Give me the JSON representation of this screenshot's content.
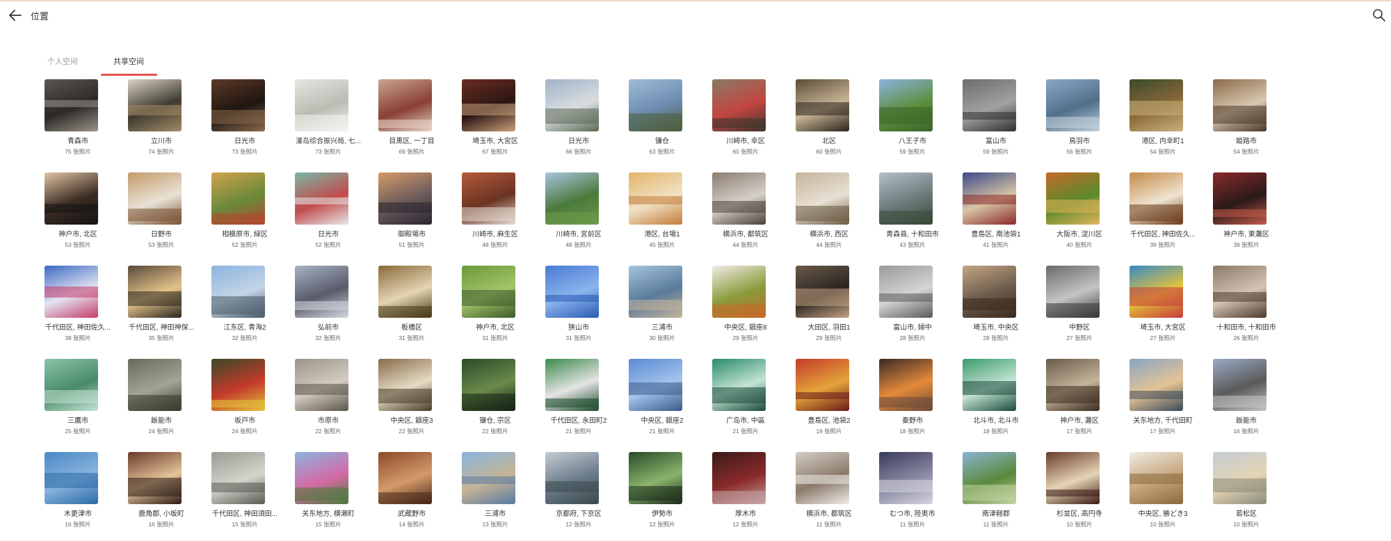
{
  "header": {
    "title": "位置",
    "back_icon": "arrow-left-icon",
    "search_icon": "search-icon"
  },
  "tabs": [
    {
      "label": "个人空间",
      "active": false
    },
    {
      "label": "共享空间",
      "active": true
    }
  ],
  "colors": {
    "accent": "#e4544d"
  },
  "locations": [
    {
      "place": "青森市",
      "count": "75 张照片",
      "colors": [
        "#5a5650",
        "#2b2926",
        "#9a948a"
      ]
    },
    {
      "place": "立川市",
      "count": "74 张照片",
      "colors": [
        "#d9d4c4",
        "#3f3a30",
        "#a48c66"
      ]
    },
    {
      "place": "日光市",
      "count": "73 张照片",
      "colors": [
        "#5c3a28",
        "#1e1511",
        "#8a6a4a"
      ]
    },
    {
      "place": "濠岛综合振兴局, 七...",
      "count": "73 张照片",
      "colors": [
        "#e6e6e2",
        "#bcbcb4",
        "#f4f4f0"
      ]
    },
    {
      "place": "目黒区, 一丁目",
      "count": "69 张照片",
      "colors": [
        "#c9a58f",
        "#8a3f35",
        "#e8d5c8"
      ]
    },
    {
      "place": "埼玉市, 大宮区",
      "count": "67 张照片",
      "colors": [
        "#6b2c22",
        "#2a1512",
        "#c9a07a"
      ]
    },
    {
      "place": "日光市",
      "count": "66 张照片",
      "colors": [
        "#9fb2c9",
        "#d9dde0",
        "#5b6a55"
      ]
    },
    {
      "place": "镰仓",
      "count": "63 张照片",
      "colors": [
        "#9fbcd6",
        "#6d8bb0",
        "#4c5e3a"
      ]
    },
    {
      "place": "川崎市, 幸区",
      "count": "60 张照片",
      "colors": [
        "#8a7a66",
        "#c2463e",
        "#3c3630"
      ]
    },
    {
      "place": "北区",
      "count": "60 张照片",
      "colors": [
        "#5c4c38",
        "#c8b496",
        "#2b241c"
      ]
    },
    {
      "place": "八王子市",
      "count": "59 张照片",
      "colors": [
        "#8bb3df",
        "#5d8f3e",
        "#3b6427"
      ]
    },
    {
      "place": "富山市",
      "count": "59 张照片",
      "colors": [
        "#6a6c6e",
        "#9fa1a3",
        "#2e3032"
      ]
    },
    {
      "place": "鳥羽市",
      "count": "56 张照片",
      "colors": [
        "#8aa8c4",
        "#50708a",
        "#c4d2dc"
      ]
    },
    {
      "place": "港区, 内幸町1",
      "count": "54 张照片",
      "colors": [
        "#3a4a2a",
        "#8c6a3a",
        "#c9b27a"
      ]
    },
    {
      "place": "姫路市",
      "count": "54 张照片",
      "colors": [
        "#8c6a4a",
        "#d8c8b0",
        "#4a3626"
      ]
    },
    {
      "place": "神户市, 北区",
      "count": "53 张照片",
      "colors": [
        "#e0c4a4",
        "#3c2c24",
        "#141414"
      ]
    },
    {
      "place": "日野市",
      "count": "53 张照片",
      "colors": [
        "#c49a6a",
        "#e8e2d6",
        "#7a5232"
      ]
    },
    {
      "place": "相模原市, 緑区",
      "count": "52 张照片",
      "colors": [
        "#d2a24a",
        "#6a8a3a",
        "#b04830"
      ]
    },
    {
      "place": "日光市",
      "count": "52 张照片",
      "colors": [
        "#7ab8a8",
        "#c24a4a",
        "#e6e8ea"
      ]
    },
    {
      "place": "御殿場市",
      "count": "51 张照片",
      "colors": [
        "#d69a6a",
        "#6a5a5a",
        "#2a2430"
      ]
    },
    {
      "place": "川崎市, 麻生区",
      "count": "48 张照片",
      "colors": [
        "#b45a3a",
        "#6a3422",
        "#e6dcd4"
      ]
    },
    {
      "place": "川崎市, 宮前区",
      "count": "48 张照片",
      "colors": [
        "#a8c4e0",
        "#4a7a3a",
        "#6b9a4a"
      ]
    },
    {
      "place": "港区, 台場1",
      "count": "45 张照片",
      "colors": [
        "#e4b46a",
        "#f0e2c4",
        "#c47a3a"
      ]
    },
    {
      "place": "横浜市, 都筑区",
      "count": "44 张照片",
      "colors": [
        "#8a7c70",
        "#d6d0c8",
        "#4a4038"
      ]
    },
    {
      "place": "横浜市, 西区",
      "count": "44 张照片",
      "colors": [
        "#c4b49a",
        "#e8e0d4",
        "#6a5a42"
      ]
    },
    {
      "place": "青森县, 十和田市",
      "count": "43 张照片",
      "colors": [
        "#b4c0c8",
        "#6a7a7a",
        "#3a4a3a"
      ]
    },
    {
      "place": "豊島区, 南池袋1",
      "count": "41 张照片",
      "colors": [
        "#3a4a8a",
        "#d8c4a4",
        "#8a2a2a"
      ]
    },
    {
      "place": "大阪市, 淀川区",
      "count": "40 张照片",
      "colors": [
        "#c46a2a",
        "#5a8a2a",
        "#e4b45a"
      ]
    },
    {
      "place": "千代田区, 神田佐久...",
      "count": "39 张照片",
      "colors": [
        "#c48a4a",
        "#f0e4d0",
        "#6a3a1a"
      ]
    },
    {
      "place": "神户市, 東灘区",
      "count": "39 张照片",
      "colors": [
        "#8a2a2a",
        "#2a1a1a",
        "#c45a4a"
      ]
    },
    {
      "place": "千代田区, 神田佐久...",
      "count": "38 张照片",
      "colors": [
        "#3a6ac4",
        "#e4e4f0",
        "#c43a6a"
      ]
    },
    {
      "place": "千代田区, 神田神保...",
      "count": "35 张照片",
      "colors": [
        "#5a4a3a",
        "#e4c48a",
        "#2a241e"
      ]
    },
    {
      "place": "江东区, 青海2",
      "count": "32 张照片",
      "colors": [
        "#8ab4e0",
        "#c4d4e4",
        "#4a5a6a"
      ]
    },
    {
      "place": "弘前市",
      "count": "32 张照片",
      "colors": [
        "#a4b4c4",
        "#5a5a6a",
        "#d4dae0"
      ]
    },
    {
      "place": "板橋区",
      "count": "31 张照片",
      "colors": [
        "#8a6a3a",
        "#e4d4b4",
        "#4a3a1a"
      ]
    },
    {
      "place": "神户市, 北区",
      "count": "31 张照片",
      "colors": [
        "#6a9a3a",
        "#a4c46a",
        "#3a5a2a"
      ]
    },
    {
      "place": "狭山市",
      "count": "31 张照片",
      "colors": [
        "#4a7ad4",
        "#8ab4ec",
        "#2a5ab4"
      ]
    },
    {
      "place": "三浦市",
      "count": "30 张照片",
      "colors": [
        "#a4c4e0",
        "#5a7a9a",
        "#c4b49a"
      ]
    },
    {
      "place": "中央区, 銀座8",
      "count": "29 张照片",
      "colors": [
        "#f0ece4",
        "#8a9a3a",
        "#c46a2a"
      ]
    },
    {
      "place": "大田区, 羽田1",
      "count": "29 张照片",
      "colors": [
        "#6a5a4a",
        "#2a2420",
        "#c4a484"
      ]
    },
    {
      "place": "富山市, 婦中",
      "count": "28 张照片",
      "colors": [
        "#9a9a9a",
        "#d4d4d4",
        "#5a5a5a"
      ]
    },
    {
      "place": "埼玉市, 中央区",
      "count": "28 张照片",
      "colors": [
        "#c4a484",
        "#6a5a4a",
        "#3a2a1e"
      ]
    },
    {
      "place": "中野区",
      "count": "27 张照片",
      "colors": [
        "#6a6a6a",
        "#c4c4c4",
        "#3a3a3a"
      ]
    },
    {
      "place": "埼玉市, 大宮区",
      "count": "27 张照片",
      "colors": [
        "#3a8ac4",
        "#e4c43a",
        "#c43a3a"
      ]
    },
    {
      "place": "十和田市, 十和田市",
      "count": "26 张照片",
      "colors": [
        "#8a7a6a",
        "#d4c4b4",
        "#4a3a2a"
      ]
    },
    {
      "place": "三鷹市",
      "count": "25 张照片",
      "colors": [
        "#8ac4aa",
        "#4a8a6a",
        "#c4e4d4"
      ]
    },
    {
      "place": "飯能市",
      "count": "24 张照片",
      "colors": [
        "#6a6a5a",
        "#a4a494",
        "#3a3a2a"
      ]
    },
    {
      "place": "坂戸市",
      "count": "24 张照片",
      "colors": [
        "#3a4a2a",
        "#c43a2a",
        "#e4c43a"
      ]
    },
    {
      "place": "市原市",
      "count": "22 张照片",
      "colors": [
        "#9a9488",
        "#d4ccc0",
        "#5a544a"
      ]
    },
    {
      "place": "中央区, 銀座3",
      "count": "22 张照片",
      "colors": [
        "#8a6a4a",
        "#e4dcc4",
        "#4a3a2a"
      ]
    },
    {
      "place": "镰仓, 宗区",
      "count": "22 张照片",
      "colors": [
        "#2a4a2a",
        "#6a8a4a",
        "#142414"
      ]
    },
    {
      "place": "千代田区, 永田町2",
      "count": "21 张照片",
      "colors": [
        "#3a8a4a",
        "#e4e4e4",
        "#1a4a2a"
      ]
    },
    {
      "place": "中央区, 銀座2",
      "count": "21 张照片",
      "colors": [
        "#5a8ad4",
        "#a4c4ec",
        "#3a5a8a"
      ]
    },
    {
      "place": "广岛市, 中區",
      "count": "21 张照片",
      "colors": [
        "#2a8a6a",
        "#c4e4d4",
        "#1a4a3a"
      ]
    },
    {
      "place": "豊島区, 池袋2",
      "count": "19 张照片",
      "colors": [
        "#c43a2a",
        "#e4a43a",
        "#6a1a1a"
      ]
    },
    {
      "place": "秦野市",
      "count": "18 张照片",
      "colors": [
        "#3a2a24",
        "#e48a3a",
        "#6a4a3a"
      ]
    },
    {
      "place": "北斗市, 北斗市",
      "count": "18 张照片",
      "colors": [
        "#3a9a6a",
        "#c4e4d4",
        "#1a4a3a"
      ]
    },
    {
      "place": "神户市, 灘区",
      "count": "17 张照片",
      "colors": [
        "#6a5a4a",
        "#c4b49a",
        "#3a2a1e"
      ]
    },
    {
      "place": "关东地方, 千代田町",
      "count": "17 张照片",
      "colors": [
        "#8aa4c4",
        "#e4c494",
        "#3a4a5a"
      ]
    },
    {
      "place": "飯能市",
      "count": "16 张照片",
      "colors": [
        "#9aaac4",
        "#5a5a5a",
        "#c4c4c4"
      ]
    },
    {
      "place": "木更津市",
      "count": "16 张照片",
      "colors": [
        "#4a8ac4",
        "#8ab4e0",
        "#2a6aa4"
      ]
    },
    {
      "place": "鹿角郡, 小坂町",
      "count": "16 张照片",
      "colors": [
        "#6a3a2a",
        "#e4c49a",
        "#2a1a14"
      ]
    },
    {
      "place": "千代田区, 神田須田...",
      "count": "15 张照片",
      "colors": [
        "#9a9a94",
        "#d4d4cc",
        "#5a5a54"
      ]
    },
    {
      "place": "关东地方, 横濑町",
      "count": "15 张照片",
      "colors": [
        "#8ab4e0",
        "#d46aa4",
        "#4a7a3a"
      ]
    },
    {
      "place": "武蔵野市",
      "count": "14 张照片",
      "colors": [
        "#8a4a2a",
        "#d49a6a",
        "#4a2a1a"
      ]
    },
    {
      "place": "三浦市",
      "count": "13 张照片",
      "colors": [
        "#8ab4e0",
        "#c4b494",
        "#5a7aa4"
      ]
    },
    {
      "place": "京都府, 下京区",
      "count": "12 张照片",
      "colors": [
        "#c4ccd4",
        "#6a7a8a",
        "#3a4a4a"
      ]
    },
    {
      "place": "伊勢市",
      "count": "12 张照片",
      "colors": [
        "#2a4a2a",
        "#8ab46a",
        "#1a2a1a"
      ]
    },
    {
      "place": "厚木市",
      "count": "12 张照片",
      "colors": [
        "#3a1a1a",
        "#8a2a2a",
        "#c4a4a4"
      ]
    },
    {
      "place": "横浜市, 都筑区",
      "count": "11 张照片",
      "colors": [
        "#d4ccc4",
        "#8a7a6a",
        "#f0ece8"
      ]
    },
    {
      "place": "むつ市, 陸奥市",
      "count": "11 张照片",
      "colors": [
        "#3a3a5a",
        "#8a8aa4",
        "#d4d4dc"
      ]
    },
    {
      "place": "南津軽郡",
      "count": "11 张照片",
      "colors": [
        "#8ab4d4",
        "#5a8a3a",
        "#c4d4a4"
      ]
    },
    {
      "place": "杉並区, 高円寺",
      "count": "10 张照片",
      "colors": [
        "#6a3a2a",
        "#e4d4b4",
        "#3a1a14"
      ]
    },
    {
      "place": "中央区, 勝どき3",
      "count": "10 张照片",
      "colors": [
        "#f0ece4",
        "#c4a47a",
        "#8a6a3a"
      ]
    },
    {
      "place": "若松区",
      "count": "10 张照片",
      "colors": [
        "#c4ccd4",
        "#e4d4b4",
        "#8a8a7a"
      ]
    }
  ]
}
